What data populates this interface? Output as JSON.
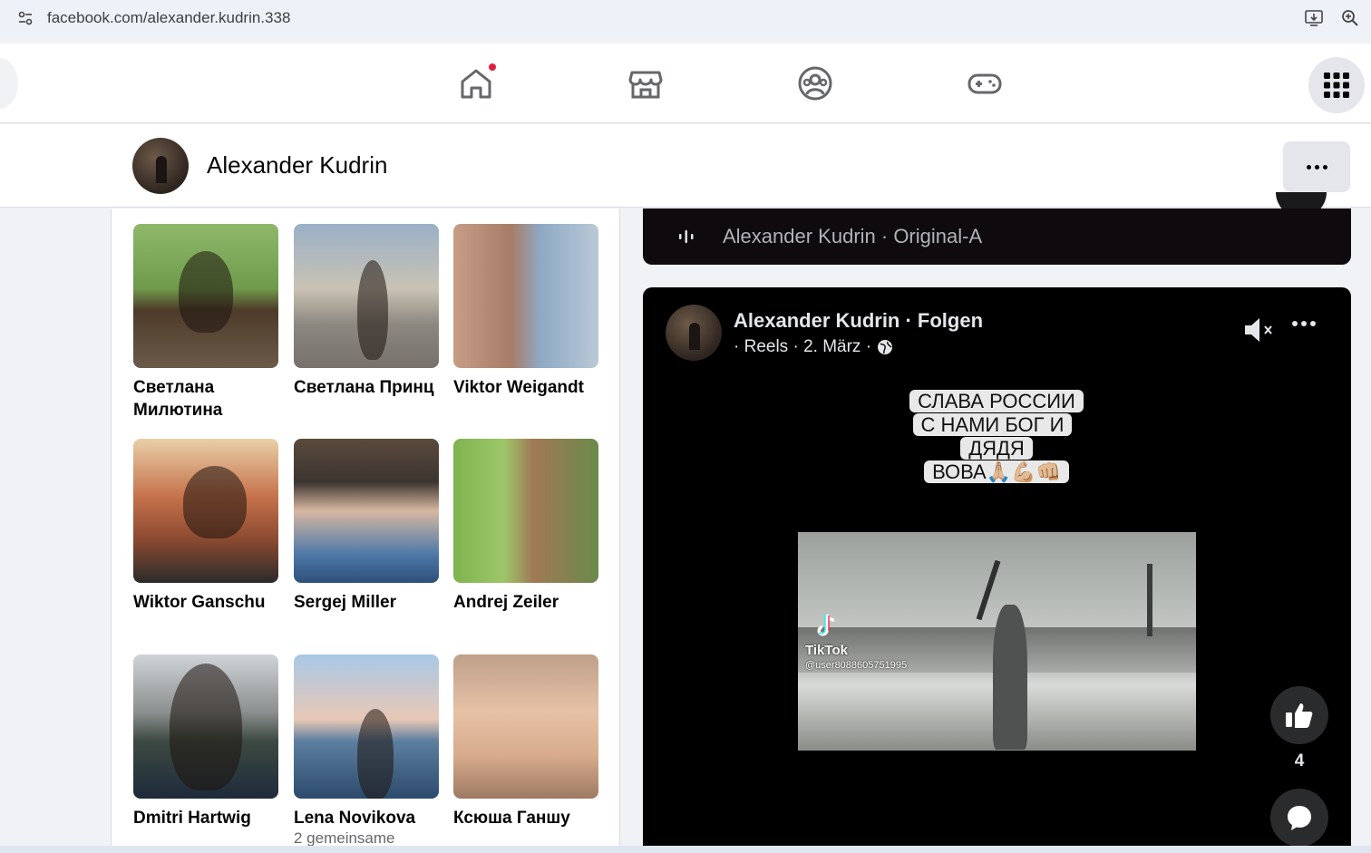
{
  "browser": {
    "url": "facebook.com/alexander.kudrin.338"
  },
  "nav": {
    "tabs": [
      {
        "icon": "home-icon",
        "has_notification": true
      },
      {
        "icon": "marketplace-icon"
      },
      {
        "icon": "groups-icon"
      },
      {
        "icon": "gaming-icon"
      }
    ],
    "menu_icon": "grid-menu-icon",
    "notification_color": "#e41e3f"
  },
  "profile": {
    "name": "Alexander Kudrin"
  },
  "friends": [
    {
      "name": "Светлана Милютина",
      "mutual": ""
    },
    {
      "name": "Светлана Принц",
      "mutual": ""
    },
    {
      "name": "Viktor Weigandt",
      "mutual": ""
    },
    {
      "name": "Wiktor Ganschu",
      "mutual": ""
    },
    {
      "name": "Sergej Miller",
      "mutual": ""
    },
    {
      "name": "Andrej Zeiler",
      "mutual": ""
    },
    {
      "name": "Dmitri Hartwig",
      "mutual": ""
    },
    {
      "name": "Lena Novikova",
      "mutual": "2 gemeinsame"
    },
    {
      "name": "Ксюша Ганшу",
      "mutual": ""
    }
  ],
  "audio": {
    "text": "Alexander Kudrin · Original-A"
  },
  "reel": {
    "author": "Alexander Kudrin · Folgen",
    "meta": "· Reels · 2. März ·",
    "caption_lines": [
      "СЛАВА РОССИИ",
      "С НАМИ БОГ И ДЯДЯ",
      "ВОВА🙏🏼💪🏼👊🏼"
    ],
    "video_brand": "TikTok",
    "video_user": "@user8088605751995",
    "like_count": "4"
  }
}
